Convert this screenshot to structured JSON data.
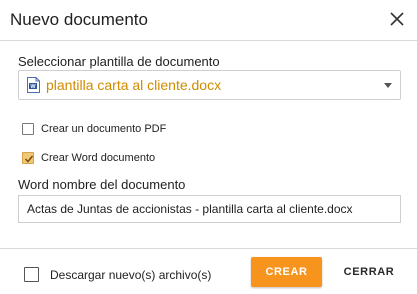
{
  "dialog": {
    "title": "Nuevo documento",
    "close_icon": "close-icon"
  },
  "template": {
    "label": "Seleccionar plantilla de documento",
    "selected": "plantilla carta al cliente.docx",
    "file_icon": "word-document-icon",
    "value_color": "#d08b00"
  },
  "options": {
    "pdf": {
      "label": "Crear un documento PDF",
      "checked": false
    },
    "word": {
      "label": "Crear Word documento",
      "checked": true
    }
  },
  "word_name": {
    "label": "Word nombre del documento",
    "value": "Actas de Juntas de accionistas - plantilla carta al cliente.docx"
  },
  "footer": {
    "download_label": "Descargar nuevo(s) archivo(s)",
    "download_checked": false,
    "create_label": "CREAR",
    "close_label": "CERRAR"
  },
  "colors": {
    "accent": "#f7941d",
    "checked_fill": "#f0c87a"
  }
}
